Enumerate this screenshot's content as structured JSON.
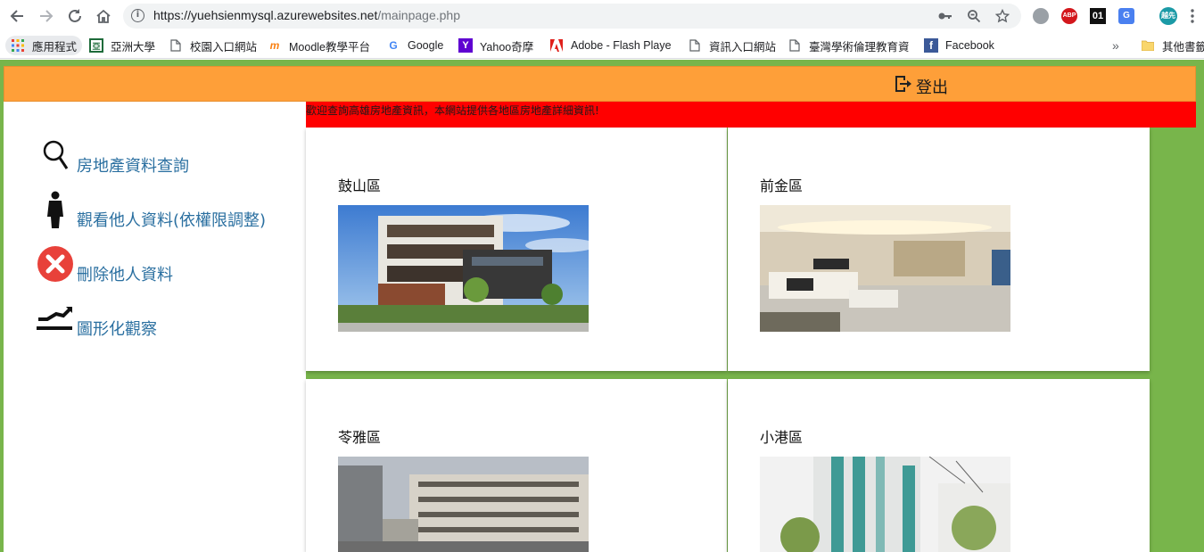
{
  "browser": {
    "url_host": "https://yuehsienmysql.azurewebsites.net",
    "url_path": "/mainpage.php",
    "profile_initials": "越先",
    "extensions": [
      "ABP",
      "01"
    ]
  },
  "bookmarks": [
    {
      "label": "應用程式",
      "icon": "apps-grid-icon"
    },
    {
      "label": "亞洲大學",
      "icon": "asia-univ-icon"
    },
    {
      "label": "校園入口網站",
      "icon": "page-icon"
    },
    {
      "label": "Moodle教學平台",
      "icon": "moodle-icon"
    },
    {
      "label": "Google",
      "icon": "google-icon"
    },
    {
      "label": "Yahoo奇摩",
      "icon": "yahoo-icon"
    },
    {
      "label": "Adobe - Flash Playe",
      "icon": "adobe-icon"
    },
    {
      "label": "資訊入口網站",
      "icon": "page-icon"
    },
    {
      "label": "臺灣學術倫理教育資",
      "icon": "page-icon"
    },
    {
      "label": "Facebook",
      "icon": "facebook-icon"
    },
    {
      "label": "其他書籤",
      "icon": "folder-icon"
    }
  ],
  "header": {
    "logout_label": "登出"
  },
  "sidebar": {
    "items": [
      {
        "label": "房地產資料查詢",
        "icon": "magnifier-icon"
      },
      {
        "label": "觀看他人資料(依權限調整)",
        "icon": "person-icon"
      },
      {
        "label": "刪除他人資料",
        "icon": "delete-circle-icon"
      },
      {
        "label": "圖形化觀察",
        "icon": "chart-trend-icon"
      }
    ]
  },
  "marquee_text": "歡迎查詢高雄房地產資訊，本網站提供各地區房地產詳細資訊!",
  "districts": [
    {
      "name": "鼓山區",
      "image": "modern-villa-photo"
    },
    {
      "name": "前金區",
      "image": "living-room-photo"
    },
    {
      "name": "苓雅區",
      "image": "street-apartments-photo"
    },
    {
      "name": "小港區",
      "image": "highrise-building-photo"
    }
  ],
  "colors": {
    "page_bg": "#78b54b",
    "topbar": "#fe9f39",
    "marquee": "#ff0000",
    "link": "#2a6fa0"
  }
}
